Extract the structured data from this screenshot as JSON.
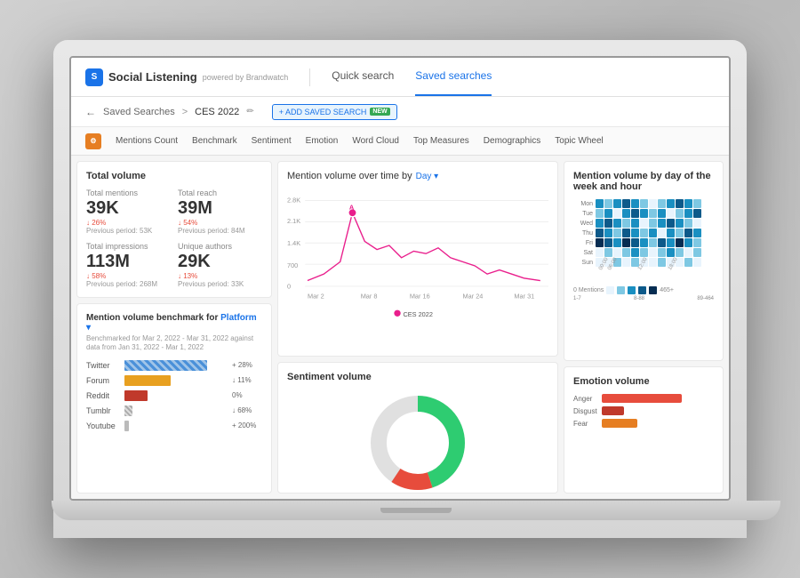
{
  "header": {
    "brand": "Social Listening",
    "powered_by": "powered by Brandwatch",
    "nav": [
      {
        "label": "Quick search",
        "active": false
      },
      {
        "label": "Saved searches",
        "active": true
      }
    ]
  },
  "breadcrumb": {
    "back": "←",
    "saved_searches": "Saved Searches",
    "separator": ">",
    "current": "CES 2022",
    "edit_icon": "✏",
    "add_btn": "+ ADD SAVED SEARCH",
    "new_badge": "NEW"
  },
  "sub_tabs": [
    "Mentions Count",
    "Benchmark",
    "Sentiment",
    "Emotion",
    "Word Cloud",
    "Top Measures",
    "Demographics",
    "Topic Wheel"
  ],
  "total_volume": {
    "title": "Total volume",
    "mentions_label": "Total mentions",
    "mentions_value": "39K",
    "mentions_change": "↓ 26%",
    "mentions_change_type": "down",
    "mentions_prev": "Previous period: 53K",
    "reach_label": "Total reach",
    "reach_value": "39M",
    "reach_change": "↓ 54%",
    "reach_change_type": "down",
    "reach_prev": "Previous period: 84M",
    "impressions_label": "Total impressions",
    "impressions_value": "113M",
    "impressions_change": "↓ 58%",
    "impressions_change_type": "down",
    "impressions_prev": "Previous period: 268M",
    "authors_label": "Unique authors",
    "authors_value": "29K",
    "authors_change": "↓ 13%",
    "authors_change_type": "down",
    "authors_prev": "Previous period: 33K"
  },
  "benchmark": {
    "title": "Mention volume benchmark for Platform",
    "subtitle": "Benchmarked for Mar 2, 2022 - Mar 31, 2022 against data from Jan 31, 2022 - Mar 1, 2022",
    "bars": [
      {
        "label": "Twitter",
        "pct": 72,
        "change": "+ 28%",
        "color": "#4a90d9",
        "pattern": true
      },
      {
        "label": "Forum",
        "pct": 40,
        "change": "↓ 11%",
        "color": "#e8a020"
      },
      {
        "label": "Reddit",
        "pct": 20,
        "change": "0%",
        "color": "#c0392b"
      },
      {
        "label": "Tumblr",
        "pct": 5,
        "change": "↓ 68%",
        "color": "#bbb"
      },
      {
        "label": "Youtube",
        "pct": 3,
        "change": "+ 200%",
        "color": "#bbb"
      }
    ]
  },
  "mention_chart": {
    "title": "Mention volume over time by",
    "day_label": "Day",
    "legend": "CES 2022",
    "y_labels": [
      "2.8K",
      "2.1K",
      "1.4K",
      "700",
      "0"
    ],
    "x_labels": [
      "Mar 2",
      "Mar 8",
      "Mar 16",
      "Mar 24",
      "Mar 31"
    ],
    "peak_value": "A",
    "series_color": "#e91e8c"
  },
  "sentiment": {
    "title": "Sentiment volume",
    "donut": {
      "segments": [
        {
          "color": "#2ecc71",
          "pct": 45
        },
        {
          "color": "#e74c3c",
          "pct": 15
        },
        {
          "color": "#95a5a6",
          "pct": 40
        }
      ]
    }
  },
  "heatmap": {
    "title": "Mention volume by day of the week and hour",
    "days": [
      "Mon",
      "Tue",
      "Wed",
      "Thu",
      "Fri",
      "Sat",
      "Sun"
    ],
    "hours_label": "00:00 - 24:00",
    "legend": [
      "0 Mentions",
      "1-7",
      "8-88",
      "89-464",
      "465+"
    ],
    "colors": [
      "#e8f4fd",
      "#7ec8e3",
      "#1a8fc1",
      "#0d5a8a",
      "#062d52"
    ]
  },
  "emotion": {
    "title": "Emotion volume",
    "bars": [
      {
        "label": "Anger",
        "pct": 70,
        "color": "#e74c3c"
      },
      {
        "label": "Disgust",
        "pct": 20,
        "color": "#c0392b"
      },
      {
        "label": "Fear",
        "pct": 30,
        "color": "#e67e22"
      }
    ]
  }
}
